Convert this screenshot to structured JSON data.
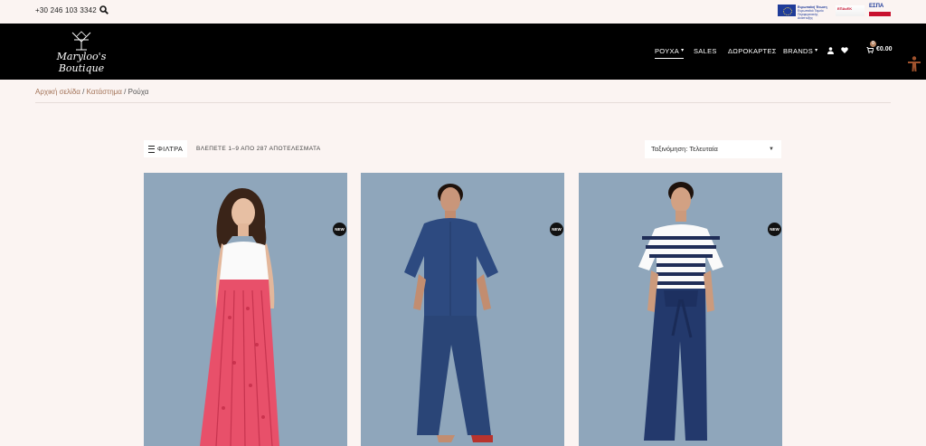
{
  "topbar": {
    "phone": "+30 246 103 3342",
    "search_icon": "search-icon",
    "eu_label": "Ευρωπαϊκή Ένωση",
    "eu_sub": "Ευρωπαϊκό Ταμείο Περιφερειακής Ανάπτυξης",
    "espa_label": "ΕΣΠΑ"
  },
  "header": {
    "logo_text": "Maryloo's Boutique",
    "nav": [
      {
        "label": "ΡΟΥΧΑ",
        "has_dropdown": true,
        "active": true
      },
      {
        "label": "SALES",
        "has_dropdown": false,
        "active": false
      },
      {
        "label": "ΔΩΡΟΚΑΡΤΕΣ",
        "has_dropdown": false,
        "active": false
      },
      {
        "label": "BRANDS",
        "has_dropdown": true,
        "active": false
      }
    ],
    "account_icon": "user-icon",
    "wishlist_icon": "heart-icon",
    "cart": {
      "count": "0",
      "total": "€0.00"
    }
  },
  "breadcrumb": [
    "Αρχική σελίδα",
    "Κατάστημα",
    "Ρούχα"
  ],
  "toolbar": {
    "filter_label": "ΦΙΛΤΡΑ",
    "result_count": "ΒΛΕΠΕΤΕ 1–9 ΑΠΟ 287 ΑΠΟΤΕΛΕΣΜΑΤΑ",
    "sort_value": "Ταξινόμηση: Τελευταία"
  },
  "products": [
    {
      "badge": "NEW",
      "colors": {
        "top": "#ffffff",
        "bottom": "#e8506a"
      }
    },
    {
      "badge": "NEW",
      "colors": {
        "top": "#2e4a7e",
        "bottom": "#2b4678"
      }
    },
    {
      "badge": "NEW",
      "colors": {
        "top": "#1d2e5a",
        "bottom": "#233a6e"
      }
    }
  ],
  "colors": {
    "header_bg": "#000000",
    "page_bg": "#fbf4f2",
    "accent": "#a27257",
    "photo_bg": "#8ea5ba"
  }
}
